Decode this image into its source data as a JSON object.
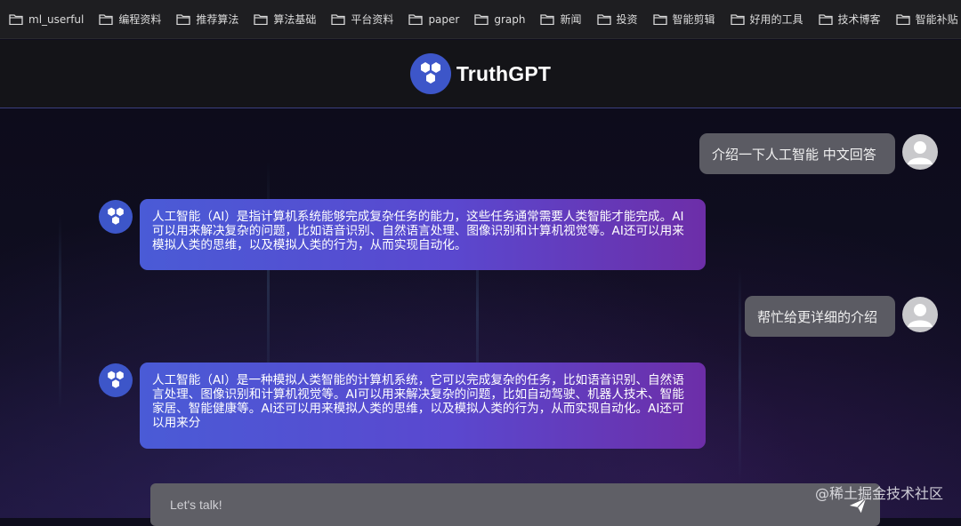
{
  "bookmarks": [
    {
      "label": "ml_userful"
    },
    {
      "label": "编程资料"
    },
    {
      "label": "推荐算法"
    },
    {
      "label": "算法基础"
    },
    {
      "label": "平台资料"
    },
    {
      "label": "paper"
    },
    {
      "label": "graph"
    },
    {
      "label": "新闻"
    },
    {
      "label": "投资"
    },
    {
      "label": "智能剪辑"
    },
    {
      "label": "好用的工具"
    },
    {
      "label": "技术博客"
    },
    {
      "label": "智能补贴"
    }
  ],
  "app": {
    "name": "TruthGPT"
  },
  "messages": [
    {
      "role": "user",
      "text": "介绍一下人工智能 中文回答"
    },
    {
      "role": "bot",
      "text": "人工智能（AI）是指计算机系统能够完成复杂任务的能力，这些任务通常需要人类智能才能完成。AI可以用来解决复杂的问题，比如语音识别、自然语言处理、图像识别和计算机视觉等。AI还可以用来模拟人类的思维，以及模拟人类的行为，从而实现自动化。"
    },
    {
      "role": "user",
      "text": "帮忙给更详细的介绍"
    },
    {
      "role": "bot",
      "text": "人工智能（AI）是一种模拟人类智能的计算机系统，它可以完成复杂的任务，比如语音识别、自然语言处理、图像识别和计算机视觉等。AI可以用来解决复杂的问题，比如自动驾驶、机器人技术、智能家居、智能健康等。AI还可以用来模拟人类的思维，以及模拟人类的行为，从而实现自动化。AI还可以用来分"
    }
  ],
  "input": {
    "placeholder": "Let's talk!"
  },
  "watermark": "@稀土掘金技术社区",
  "colors": {
    "brand": "#3d56c9",
    "bot_bubble_start": "#4a5bd6",
    "bot_bubble_end": "#6d2ea8",
    "user_bubble": "#5b5b63"
  }
}
